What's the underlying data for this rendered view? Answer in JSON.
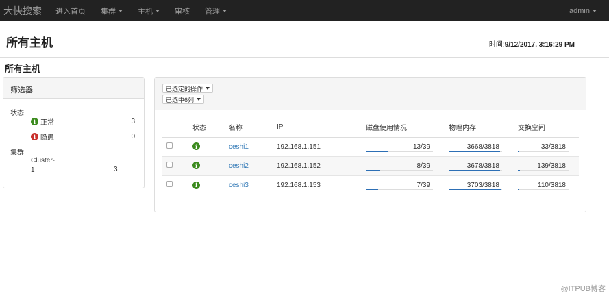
{
  "navbar": {
    "brand": "大快搜索",
    "items": [
      {
        "label": "进入首页",
        "dropdown": false
      },
      {
        "label": "集群",
        "dropdown": true
      },
      {
        "label": "主机",
        "dropdown": true
      },
      {
        "label": "审核",
        "dropdown": false
      },
      {
        "label": "管理",
        "dropdown": true
      }
    ],
    "user": "admin"
  },
  "header": {
    "title": "所有主机",
    "time_label": "时间:",
    "time_value": "9/12/2017, 3:16:29 PM"
  },
  "section_title": "所有主机",
  "filter": {
    "title": "筛选器",
    "status_label": "状态",
    "status_items": [
      {
        "label": "正常",
        "count": "3",
        "color": "#3c8b1e"
      },
      {
        "label": "隐患",
        "count": "0",
        "color": "#c9302c"
      }
    ],
    "cluster_label": "集群",
    "cluster_name_line1": "Cluster-",
    "cluster_name_line2": "1",
    "cluster_count": "3"
  },
  "hosts": {
    "actions_dropdown": "已选定的操作",
    "columns_dropdown": "已选中6列",
    "columns": [
      "状态",
      "名称",
      "IP",
      "磁盘使用情况",
      "物理内存",
      "交换空间"
    ],
    "rows": [
      {
        "name": "ceshi1",
        "ip": "192.168.1.151",
        "disk": "13/39",
        "disk_ratio": 0.333,
        "mem": "3668/3818",
        "mem_ratio": 0.961,
        "swap": "33/3818",
        "swap_ratio": 0.009
      },
      {
        "name": "ceshi2",
        "ip": "192.168.1.152",
        "disk": "8/39",
        "disk_ratio": 0.205,
        "mem": "3678/3818",
        "mem_ratio": 0.963,
        "swap": "139/3818",
        "swap_ratio": 0.036
      },
      {
        "name": "ceshi3",
        "ip": "192.168.1.153",
        "disk": "7/39",
        "disk_ratio": 0.179,
        "mem": "3703/3818",
        "mem_ratio": 0.97,
        "swap": "110/3818",
        "swap_ratio": 0.029
      }
    ]
  },
  "watermark": "@ITPUB博客",
  "colors": {
    "navbar": "#222222",
    "link": "#337ab7",
    "ok": "#3c8b1e",
    "warn": "#c9302c",
    "meter_fill": "#2d6fb5"
  }
}
